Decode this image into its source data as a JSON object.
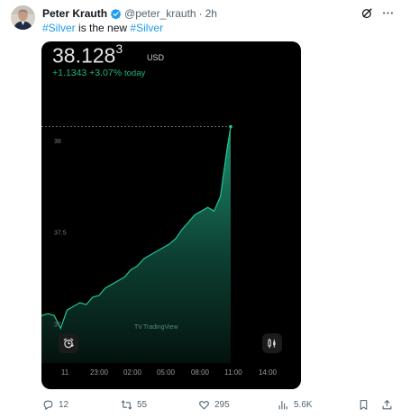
{
  "author": {
    "name": "Peter Krauth",
    "handle": "@peter_krauth",
    "separator": "·",
    "time": "2h"
  },
  "tweet": {
    "hashtag1": "#Silver",
    "middle_text": " is the new ",
    "hashtag2": "#Silver"
  },
  "quote": {
    "price_main": "38.128",
    "price_sup": "3",
    "currency": "USD",
    "change": "+1.1343",
    "change_pct": "+3.07%",
    "change_period": "today",
    "watermark": "TradingView"
  },
  "chart_data": {
    "type": "area",
    "title": "",
    "xlabel": "",
    "ylabel": "",
    "y_ticks": [
      "38",
      "37.5",
      "37"
    ],
    "x_ticks": [
      "11",
      "23:00",
      "02:00",
      "05:00",
      "08:00",
      "11:00",
      "14:00"
    ],
    "ylim": [
      36.85,
      38.25
    ],
    "x": [
      21.0,
      21.5,
      22.0,
      22.5,
      23.0,
      23.5,
      24.0,
      24.5,
      25.0,
      25.5,
      26.0,
      26.5,
      27.0,
      27.5,
      28.0,
      28.5,
      29.0,
      29.5,
      30.0,
      30.5,
      31.0,
      31.5,
      32.0,
      32.5,
      33.0,
      33.5,
      34.0,
      34.5,
      35.0,
      35.5,
      35.8
    ],
    "values": [
      37.05,
      37.06,
      37.05,
      36.98,
      37.08,
      37.1,
      37.12,
      37.11,
      37.15,
      37.16,
      37.2,
      37.22,
      37.24,
      37.26,
      37.3,
      37.32,
      37.36,
      37.38,
      37.4,
      37.42,
      37.44,
      37.47,
      37.52,
      37.56,
      37.6,
      37.62,
      37.64,
      37.62,
      37.7,
      37.95,
      38.08
    ],
    "reference_line": 38.08,
    "series_color": "#22c497",
    "grid": false
  },
  "actions": {
    "replies": "12",
    "reposts": "55",
    "likes": "295",
    "views": "5.6K"
  },
  "colors": {
    "accent": "#1d9bf0",
    "positive": "#1fb483",
    "muted": "#536471"
  },
  "icons": [
    "verified-badge-icon",
    "grok-icon",
    "more-icon",
    "alarm-icon",
    "indicators-icon",
    "reply-icon",
    "repost-icon",
    "like-icon",
    "views-icon",
    "bookmark-icon",
    "share-icon"
  ]
}
